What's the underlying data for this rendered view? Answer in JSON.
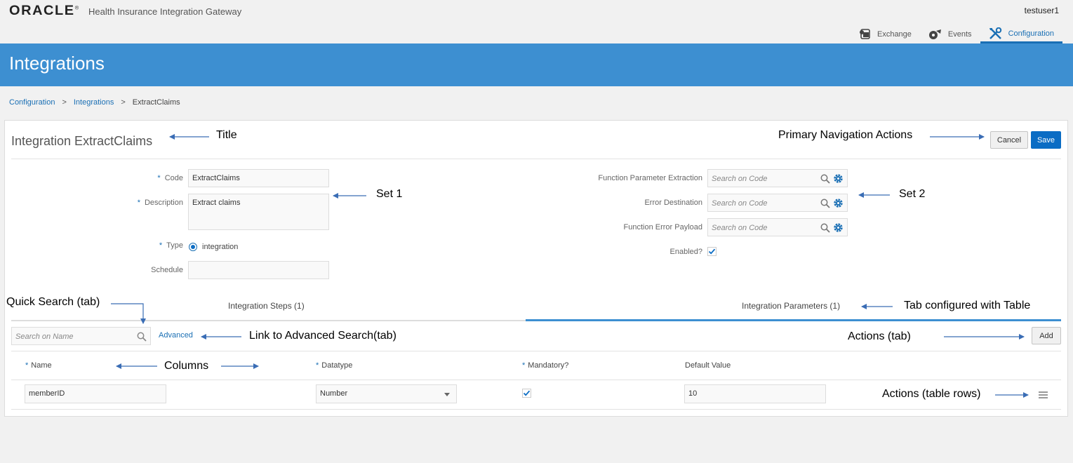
{
  "header": {
    "logo": "ORACLE",
    "app_name": "Health Insurance Integration Gateway",
    "user": "testuser1",
    "nav_tabs": [
      {
        "label": "Exchange",
        "icon": "exchange-icon"
      },
      {
        "label": "Events",
        "icon": "events-icon"
      },
      {
        "label": "Configuration",
        "icon": "wrench-screwdriver-icon",
        "active": true
      }
    ]
  },
  "banner": {
    "title": "Integrations"
  },
  "breadcrumb": [
    "Configuration",
    "Integrations",
    "ExtractClaims"
  ],
  "form": {
    "title": "Integration ExtractClaims",
    "cancel_label": "Cancel",
    "save_label": "Save",
    "code_label": "Code",
    "code_value": "ExtractClaims",
    "description_label": "Description",
    "description_value": "Extract claims",
    "type_label": "Type",
    "type_value": "integration",
    "schedule_label": "Schedule",
    "schedule_value": "",
    "fpe_label": "Function Parameter Extraction",
    "error_dest_label": "Error Destination",
    "fep_label": "Function Error Payload",
    "search_placeholder": "Search on Code",
    "enabled_label": "Enabled?",
    "enabled": true
  },
  "tabs": [
    {
      "label": "Integration Steps (1)",
      "active": false
    },
    {
      "label": "Integration Parameters (1)",
      "active": true
    }
  ],
  "table": {
    "search_placeholder": "Search on Name",
    "advanced_label": "Advanced",
    "add_label": "Add",
    "columns": [
      "Name",
      "Datatype",
      "Mandatory?",
      "Default Value"
    ],
    "rows": [
      {
        "name": "memberID",
        "datatype": "Number",
        "mandatory": true,
        "default_value": "10"
      }
    ]
  },
  "annotations": {
    "title": "Title",
    "primary_nav": "Primary Navigation Actions",
    "set1": "Set 1",
    "set2": "Set 2",
    "quick_search": "Quick Search (tab)",
    "tab_table": "Tab configured with Table",
    "advanced_link": "Link to Advanced Search(tab)",
    "actions_tab": "Actions (tab)",
    "columns": "Columns",
    "actions_rows": "Actions (table rows)"
  },
  "colors": {
    "banner": "#3d8fd1",
    "primary_button": "#0a6cc4",
    "link": "#1a6fb4",
    "annotation_arrow": "#3a6db5"
  }
}
